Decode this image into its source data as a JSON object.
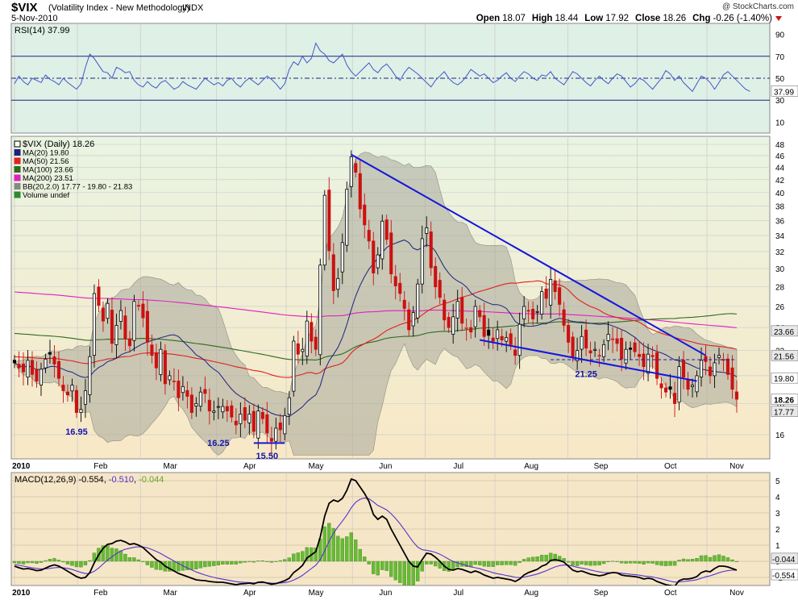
{
  "header": {
    "symbol": "$VIX",
    "name": "(Volatility Index - New Methodology)",
    "exchange": "INDX",
    "date": "5-Nov-2010",
    "copyright": "@ StockCharts.com",
    "ohlc": {
      "open_label": "Open",
      "open": "18.07",
      "high_label": "High",
      "high": "18.44",
      "low_label": "Low",
      "low": "17.92",
      "close_label": "Close",
      "close": "18.26",
      "chg_label": "Chg",
      "chg": "-0.26 (-1.40%)"
    }
  },
  "colors": {
    "rsi_bg": "#dff0e6",
    "price_bg_top": "#e9f4e2",
    "price_bg_bottom": "#f8e8c6",
    "macd_bg": "#f6e6c8",
    "up_candle": "#000000",
    "down_candle": "#cc1111",
    "ma20": "#1a237e",
    "ma50": "#dd2222",
    "ma100": "#2d6b1f",
    "ma200": "#e020c0",
    "bb_fill": "#a8a79a",
    "trendline": "#1515dd",
    "rsi_line": "#4455cc",
    "macd_line": "#000000",
    "signal_line": "#5533cc",
    "histogram": "#66bb33"
  },
  "chart_data": [
    {
      "panel": "rsi",
      "type": "line",
      "legend": "RSI(14) 37.99",
      "last_value_label": "37.99",
      "y_ticks": [
        "90",
        "70",
        "50",
        "30",
        "10"
      ],
      "reference_levels": [
        70,
        50,
        30
      ],
      "ylim": [
        0,
        100
      ],
      "series": [
        {
          "name": "RSI(14)",
          "values": [
            45,
            52,
            47,
            44,
            50,
            48,
            46,
            53,
            49,
            47,
            44,
            50,
            46,
            43,
            40,
            45,
            60,
            72,
            68,
            62,
            56,
            55,
            50,
            60,
            58,
            55,
            56,
            48,
            44,
            42,
            47,
            43,
            41,
            46,
            48,
            44,
            40,
            42,
            47,
            44,
            42,
            40,
            45,
            50,
            47,
            44,
            46,
            43,
            48,
            50,
            45,
            42,
            47,
            50,
            47,
            44,
            48,
            52,
            49,
            45,
            40,
            45,
            58,
            65,
            62,
            70,
            64,
            68,
            82,
            75,
            72,
            66,
            64,
            68,
            72,
            62,
            56,
            52,
            56,
            60,
            64,
            58,
            55,
            60,
            63,
            58,
            52,
            48,
            55,
            60,
            57,
            54,
            50,
            46,
            42,
            48,
            52,
            56,
            50,
            46,
            44,
            47,
            52,
            58,
            55,
            52,
            54,
            50,
            46,
            48,
            52,
            55,
            50,
            47,
            52,
            56,
            54,
            50,
            48,
            53,
            52,
            56,
            50,
            47,
            44,
            50,
            56,
            54,
            50,
            46,
            43,
            48,
            52,
            48,
            45,
            50,
            54,
            52,
            47,
            42,
            45,
            50,
            48,
            44,
            40,
            45,
            50,
            57,
            54,
            48,
            52,
            46,
            42,
            38,
            45,
            52,
            50,
            46,
            40,
            46,
            53,
            56,
            52,
            48,
            44,
            40,
            38
          ]
        }
      ]
    },
    {
      "panel": "price",
      "type": "candlestick",
      "title": "$VIX (Daily) 18.26",
      "legend": [
        {
          "label": "$VIX (Daily) 18.26",
          "color": "#000000"
        },
        {
          "label": "MA(20) 19.80",
          "color": "#1a237e"
        },
        {
          "label": "MA(50) 21.56",
          "color": "#dd2222"
        },
        {
          "label": "MA(100) 23.66",
          "color": "#2d6b1f"
        },
        {
          "label": "MA(200) 23.51",
          "color": "#e020c0"
        },
        {
          "label": "BB(20,2.0) 17.77 - 19.80 - 21.83",
          "color": "#888888"
        },
        {
          "label": "Volume undef",
          "color": "#2d8a2d"
        }
      ],
      "y_ticks": [
        "48",
        "46",
        "44",
        "42",
        "40",
        "38",
        "36",
        "34",
        "32",
        "30",
        "28",
        "26",
        "24",
        "22",
        "20",
        "18",
        "16"
      ],
      "right_labels": [
        "23.66",
        "21.56",
        "19.80",
        "18.26",
        "17.77"
      ],
      "annotations": [
        "16.95",
        "16.25",
        "15.50",
        "21.25"
      ],
      "x_labels": [
        "2010",
        "Feb",
        "Mar",
        "Apr",
        "May",
        "Jun",
        "Jul",
        "Aug",
        "Sep",
        "Oct",
        "Nov"
      ],
      "log_scale": true,
      "close": [
        21.0,
        20.6,
        20.3,
        21.2,
        20.1,
        19.6,
        20.5,
        21.3,
        21.7,
        20.9,
        19.8,
        18.9,
        18.6,
        19.3,
        17.4,
        17.6,
        18.9,
        21.5,
        27.3,
        26.1,
        24.6,
        26.3,
        22.6,
        24.2,
        25.6,
        23.0,
        22.4,
        26.5,
        26.1,
        24.9,
        22.7,
        21.6,
        20.6,
        22.1,
        19.4,
        20.0,
        19.6,
        18.4,
        19.2,
        18.5,
        17.4,
        18.0,
        18.8,
        18.7,
        17.5,
        17.5,
        17.8,
        17.8,
        17.5,
        17.1,
        16.6,
        17.3,
        16.9,
        17.3,
        16.2,
        17.5,
        17.0,
        16.1,
        15.6,
        16.4,
        16.3,
        17.2,
        18.4,
        22.8,
        21.7,
        22.1,
        24.6,
        22.8,
        22.1,
        30.4,
        39.6,
        32.1,
        27.6,
        28.9,
        33.1,
        40.5,
        45.8,
        43.2,
        37.6,
        35.4,
        33.3,
        29.5,
        31.6,
        35.9,
        33.5,
        29.4,
        28.1,
        27.3,
        25.8,
        23.8,
        25.4,
        28.3,
        33.6,
        35.0,
        30.1,
        28.0,
        26.9,
        24.7,
        24.0,
        25.0,
        26.5,
        24.4,
        24.0,
        23.6,
        26.0,
        25.0,
        23.2,
        23.3,
        22.8,
        23.8,
        22.9,
        23.1,
        22.5,
        21.6,
        24.3,
        26.0,
        25.6,
        24.8,
        25.5,
        27.5,
        26.8,
        28.8,
        27.5,
        26.2,
        24.2,
        22.7,
        21.5,
        22.0,
        23.2,
        22.2,
        21.8,
        22.1,
        21.6,
        22.5,
        23.4,
        23.0,
        22.6,
        21.3,
        22.1,
        22.1,
        21.9,
        21.5,
        20.7,
        21.7,
        21.5,
        19.8,
        19.1,
        18.8,
        19.0,
        18.0,
        20.7,
        19.9,
        19.0,
        19.3,
        20.0,
        21.2,
        21.1,
        20.0,
        21.0,
        21.6,
        21.2,
        20.1,
        19.0,
        18.3
      ]
    },
    {
      "panel": "macd",
      "type": "line",
      "legend": "MACD(12,26,9) -0.554, -0.510, -0.044",
      "legend_values": [
        "-0.554",
        "-0.510",
        "-0.044"
      ],
      "y_ticks": [
        "5",
        "4",
        "3",
        "2",
        "1",
        "0",
        "-1"
      ],
      "right_labels": [
        "-0.044",
        "-0.554"
      ],
      "x_labels": [
        "2010",
        "Feb",
        "Mar",
        "Apr",
        "May",
        "Jun",
        "Jul",
        "Aug",
        "Sep",
        "Oct",
        "Nov"
      ],
      "ylim": [
        -1.5,
        5.5
      ],
      "series": [
        {
          "name": "MACD(12,26,9)",
          "values": [
            -0.3,
            -0.4,
            -0.48,
            -0.45,
            -0.5,
            -0.58,
            -0.55,
            -0.42,
            -0.3,
            -0.22,
            -0.3,
            -0.45,
            -0.62,
            -0.78,
            -0.95,
            -1.05,
            -1.0,
            -0.7,
            -0.1,
            0.4,
            0.8,
            1.05,
            1.1,
            1.25,
            1.3,
            1.2,
            1.05,
            1.1,
            1.0,
            0.85,
            0.6,
            0.35,
            0.1,
            -0.05,
            -0.3,
            -0.45,
            -0.6,
            -0.75,
            -0.85,
            -0.95,
            -1.05,
            -1.15,
            -1.18,
            -1.2,
            -1.25,
            -1.28,
            -1.3,
            -1.3,
            -1.35,
            -1.4,
            -1.45,
            -1.4,
            -1.38,
            -1.35,
            -1.4,
            -1.3,
            -1.28,
            -1.35,
            -1.42,
            -1.38,
            -1.3,
            -1.2,
            -1.05,
            -0.7,
            -0.5,
            -0.25,
            0.2,
            0.4,
            0.6,
            1.5,
            2.8,
            3.6,
            3.8,
            3.7,
            3.9,
            4.4,
            5.1,
            5.0,
            4.6,
            4.2,
            3.7,
            2.9,
            2.6,
            2.8,
            2.6,
            2.0,
            1.5,
            1.0,
            0.5,
            0.0,
            -0.3,
            -0.35,
            0.1,
            0.5,
            0.45,
            0.25,
            0.0,
            -0.3,
            -0.5,
            -0.55,
            -0.45,
            -0.5,
            -0.6,
            -0.7,
            -0.6,
            -0.7,
            -0.85,
            -0.95,
            -1.05,
            -1.0,
            -1.05,
            -1.1,
            -1.15,
            -1.25,
            -1.1,
            -0.85,
            -0.7,
            -0.6,
            -0.5,
            -0.3,
            -0.2,
            0.05,
            0.1,
            0.05,
            -0.05,
            -0.3,
            -0.55,
            -0.65,
            -0.6,
            -0.7,
            -0.8,
            -0.85,
            -0.9,
            -0.85,
            -0.75,
            -0.7,
            -0.72,
            -0.85,
            -0.9,
            -0.92,
            -0.95,
            -1.0,
            -1.1,
            -1.05,
            -1.1,
            -1.25,
            -1.35,
            -1.45,
            -1.5,
            -1.55,
            -1.2,
            -1.1,
            -1.1,
            -1.05,
            -0.95,
            -0.7,
            -0.6,
            -0.65,
            -0.45,
            -0.3,
            -0.3,
            -0.35,
            -0.45,
            -0.55
          ]
        },
        {
          "name": "Signal",
          "values": [
            -0.2,
            -0.25,
            -0.3,
            -0.35,
            -0.4,
            -0.44,
            -0.47,
            -0.47,
            -0.44,
            -0.4,
            -0.38,
            -0.4,
            -0.44,
            -0.51,
            -0.6,
            -0.69,
            -0.76,
            -0.75,
            -0.62,
            -0.42,
            -0.17,
            0.07,
            0.28,
            0.47,
            0.64,
            0.75,
            0.81,
            0.87,
            0.9,
            0.89,
            0.83,
            0.73,
            0.61,
            0.48,
            0.32,
            0.17,
            0.02,
            -0.14,
            -0.28,
            -0.41,
            -0.54,
            -0.66,
            -0.76,
            -0.85,
            -0.93,
            -1.0,
            -1.06,
            -1.11,
            -1.16,
            -1.21,
            -1.26,
            -1.29,
            -1.31,
            -1.32,
            -1.34,
            -1.33,
            -1.32,
            -1.33,
            -1.35,
            -1.36,
            -1.35,
            -1.32,
            -1.27,
            -1.16,
            -1.03,
            -0.87,
            -0.66,
            -0.45,
            -0.24,
            0.11,
            0.65,
            1.24,
            1.75,
            2.14,
            2.49,
            2.87,
            3.32,
            3.66,
            3.85,
            3.92,
            3.88,
            3.68,
            3.46,
            3.33,
            3.19,
            2.95,
            2.66,
            2.33,
            1.96,
            1.57,
            1.19,
            0.88,
            0.72,
            0.68,
            0.63,
            0.55,
            0.44,
            0.29,
            0.13,
            -0.01,
            -0.1,
            -0.18,
            -0.26,
            -0.35,
            -0.4,
            -0.46,
            -0.54,
            -0.62,
            -0.71,
            -0.77,
            -0.82,
            -0.88,
            -0.93,
            -0.99,
            -1.01,
            -0.98,
            -0.92,
            -0.86,
            -0.79,
            -0.69,
            -0.59,
            -0.46,
            -0.35,
            -0.27,
            -0.23,
            -0.24,
            -0.3,
            -0.37,
            -0.42,
            -0.47,
            -0.54,
            -0.6,
            -0.66,
            -0.7,
            -0.71,
            -0.71,
            -0.71,
            -0.74,
            -0.77,
            -0.8,
            -0.83,
            -0.86,
            -0.91,
            -0.94,
            -0.97,
            -1.03,
            -1.09,
            -1.16,
            -1.23,
            -1.29,
            -1.28,
            -1.25,
            -1.22,
            -1.19,
            -1.14,
            -1.05,
            -0.96,
            -0.9,
            -0.81,
            -0.71,
            -0.63,
            -0.58,
            -0.55,
            -0.55
          ]
        },
        {
          "name": "Histogram",
          "values": [
            -0.1,
            -0.15,
            -0.18,
            -0.1,
            -0.1,
            -0.14,
            -0.08,
            0.05,
            0.14,
            0.18,
            0.08,
            -0.05,
            -0.18,
            -0.27,
            -0.35,
            -0.36,
            -0.24,
            0.05,
            0.52,
            0.82,
            0.97,
            0.98,
            0.82,
            0.78,
            0.66,
            0.45,
            0.24,
            0.23,
            0.1,
            -0.04,
            -0.23,
            -0.38,
            -0.51,
            -0.53,
            -0.62,
            -0.62,
            -0.62,
            -0.61,
            -0.57,
            -0.54,
            -0.51,
            -0.49,
            -0.42,
            -0.35,
            -0.32,
            -0.28,
            -0.24,
            -0.19,
            -0.19,
            -0.19,
            -0.19,
            -0.11,
            -0.07,
            -0.03,
            -0.06,
            0.03,
            0.04,
            -0.02,
            -0.07,
            -0.02,
            0.05,
            0.12,
            0.22,
            0.46,
            0.53,
            0.62,
            0.86,
            0.85,
            0.84,
            1.39,
            2.15,
            2.36,
            2.05,
            1.56,
            1.41,
            1.53,
            1.78,
            1.34,
            0.75,
            0.28,
            -0.18,
            -0.78,
            -0.86,
            -0.53,
            -0.59,
            -0.95,
            -1.16,
            -1.33,
            -1.46,
            -1.57,
            -1.49,
            -1.23,
            -0.62,
            -0.18,
            -0.18,
            -0.3,
            -0.44,
            -0.59,
            -0.63,
            -0.54,
            -0.35,
            -0.32,
            -0.34,
            -0.35,
            -0.2,
            -0.24,
            -0.31,
            -0.33,
            -0.34,
            -0.23,
            -0.23,
            -0.22,
            -0.22,
            -0.26,
            -0.09,
            0.13,
            0.22,
            0.26,
            0.29,
            0.39,
            0.39,
            0.51,
            0.45,
            0.32,
            0.18,
            -0.06,
            -0.25,
            -0.28,
            -0.18,
            -0.23,
            -0.26,
            -0.25,
            -0.24,
            -0.15,
            -0.04,
            0.01,
            -0.01,
            -0.11,
            -0.13,
            -0.12,
            -0.12,
            -0.14,
            -0.19,
            -0.11,
            -0.13,
            -0.22,
            -0.26,
            -0.29,
            -0.27,
            -0.26,
            0.08,
            0.15,
            0.12,
            0.14,
            0.19,
            0.35,
            0.36,
            0.25,
            0.36,
            0.41,
            0.33,
            0.23,
            0.1,
            -0.04
          ]
        }
      ]
    }
  ]
}
